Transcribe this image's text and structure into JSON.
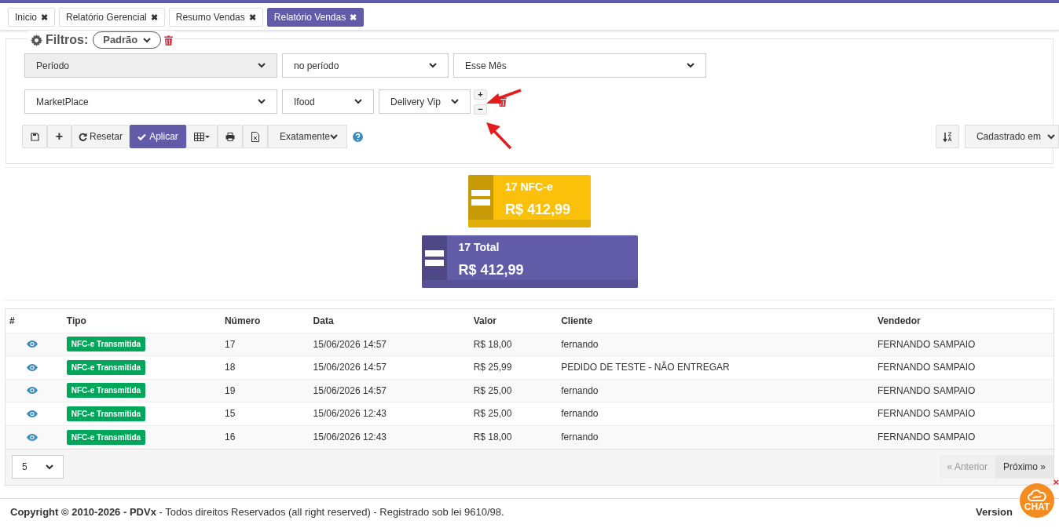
{
  "tabs": [
    {
      "label": "Inicio",
      "close": "✖",
      "selected": false
    },
    {
      "label": "Relatório Gerencial",
      "close": "✖",
      "selected": false
    },
    {
      "label": "Resumo Vendas",
      "close": "✖",
      "selected": false
    },
    {
      "label": "Relatório Vendas",
      "close": "✖",
      "selected": true
    }
  ],
  "filters": {
    "title": "Filtros:",
    "preset": "Padrão",
    "rows": [
      {
        "field": "Período",
        "operator": "no período",
        "values": [
          "Esse Mês"
        ],
        "disabled": true
      },
      {
        "field": "MarketPlace",
        "operator": "Ifood",
        "values": [
          "Delivery Vip"
        ],
        "disabled": false,
        "add": "+",
        "remove": "−"
      }
    ],
    "toolbar": {
      "add": "+",
      "reset": "Resetar",
      "apply": "Aplicar",
      "match": "Exatamente",
      "sort": "Cadastrado em"
    }
  },
  "cards": [
    {
      "count": "17 NFC-e",
      "amount": "R$ 412,99",
      "color": "#fbc10a"
    },
    {
      "count": "17 Total",
      "amount": "R$ 412,99",
      "color": "#615ba8"
    }
  ],
  "table": {
    "columns": [
      "#",
      "Tipo",
      "Número",
      "Data",
      "Valor",
      "Cliente",
      "Vendedor"
    ],
    "rows": [
      {
        "tipo": "NFC-e Transmitida",
        "numero": "17",
        "data": "15/06/2026 14:57",
        "valor": "R$ 18,00",
        "cliente": "fernando",
        "vendedor": "FERNANDO SAMPAIO"
      },
      {
        "tipo": "NFC-e Transmitida",
        "numero": "18",
        "data": "15/06/2026 14:57",
        "valor": "R$ 25,99",
        "cliente": "PEDIDO DE TESTE - NÃO ENTREGAR",
        "vendedor": "FERNANDO SAMPAIO"
      },
      {
        "tipo": "NFC-e Transmitida",
        "numero": "19",
        "data": "15/06/2026 14:57",
        "valor": "R$ 25,00",
        "cliente": "fernando",
        "vendedor": "FERNANDO SAMPAIO"
      },
      {
        "tipo": "NFC-e Transmitida",
        "numero": "15",
        "data": "15/06/2026 12:43",
        "valor": "R$ 25,00",
        "cliente": "fernando",
        "vendedor": "FERNANDO SAMPAIO"
      },
      {
        "tipo": "NFC-e Transmitida",
        "numero": "16",
        "data": "15/06/2026 12:43",
        "valor": "R$ 18,00",
        "cliente": "fernando",
        "vendedor": "FERNANDO SAMPAIO"
      }
    ]
  },
  "pagination": {
    "page_size": "5",
    "previous": {
      "label": "« Anterior",
      "disabled": true
    },
    "next": {
      "label": "Próximo »",
      "disabled": false
    }
  },
  "footer": {
    "copyright": "**Copyright © 2010-2026 - PDVx** - Todos direitos Reservados (all right reserved) - Registrado sob lei 9610/98.",
    "version": "Version"
  },
  "chat": {
    "label": "CHAT",
    "close": "×"
  }
}
